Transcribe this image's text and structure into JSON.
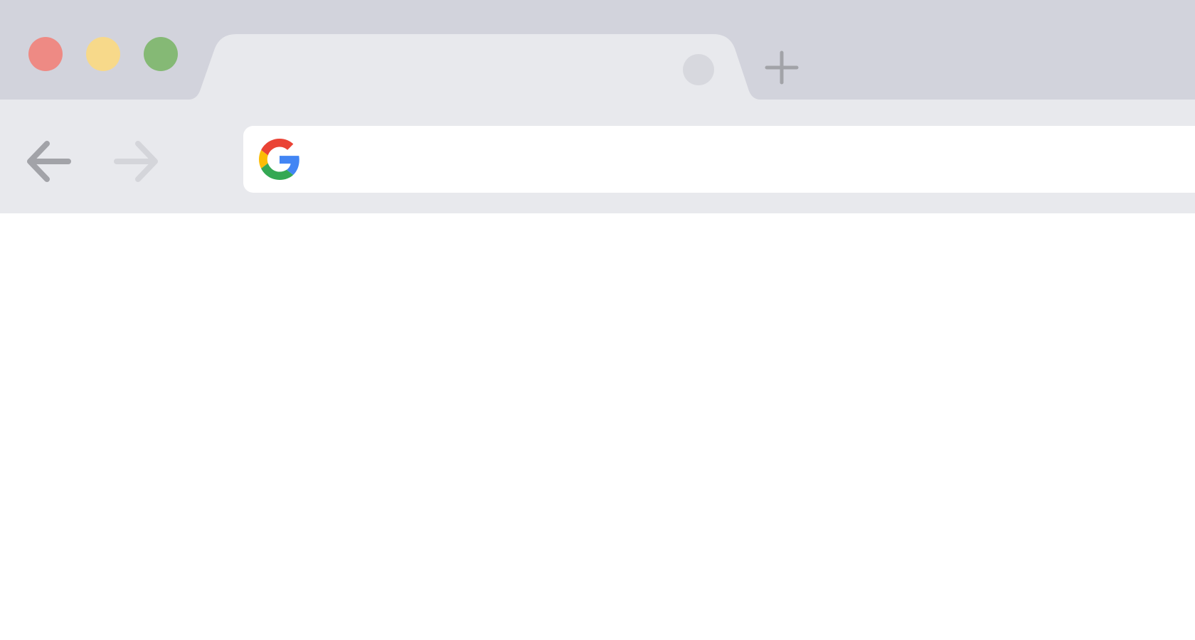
{
  "window": {
    "controls": {
      "close_color": "#ee8a84",
      "minimize_color": "#f7d98a",
      "maximize_color": "#85b975"
    }
  },
  "tab": {
    "title": "",
    "favicon_icon": "placeholder-circle-icon"
  },
  "new_tab_icon": "plus-icon",
  "toolbar": {
    "back_icon": "arrow-left-icon",
    "forward_icon": "arrow-right-icon",
    "omnibox": {
      "icon": "google-g-icon",
      "value": "",
      "placeholder": ""
    }
  },
  "colors": {
    "tabstrip_bg": "#d2d3dc",
    "toolbar_bg": "#e8e9ed",
    "content_bg": "#ffffff",
    "icon_active": "#a2a3a8",
    "icon_disabled": "#d4d5da"
  }
}
